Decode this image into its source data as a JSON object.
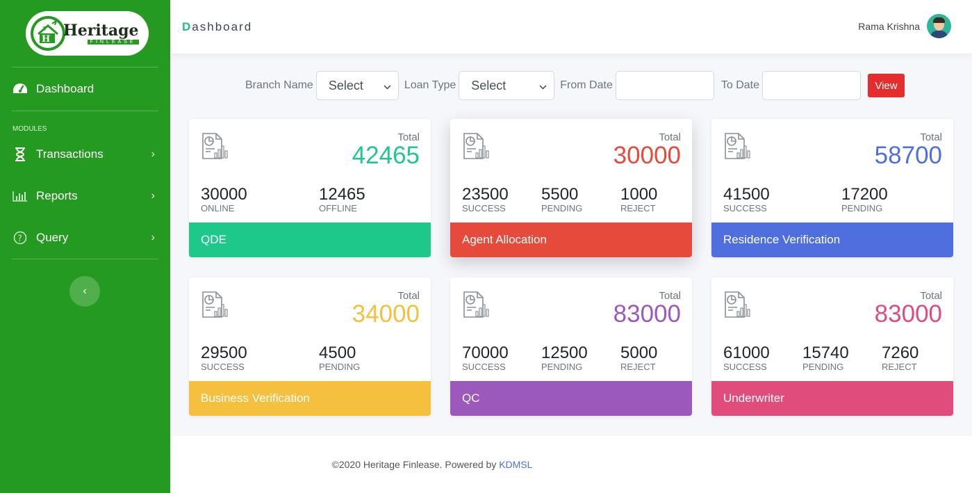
{
  "brand": {
    "name": "Heritage",
    "tagline": "FINLEASE"
  },
  "sidebar": {
    "dashboard_label": "Dashboard",
    "modules_label": "MODULES",
    "items": [
      {
        "label": "Transactions",
        "icon": "hourglass-icon"
      },
      {
        "label": "Reports",
        "icon": "bar-chart-icon"
      },
      {
        "label": "Query",
        "icon": "question-circle-icon"
      }
    ],
    "collapse_icon": "chevron-left-icon"
  },
  "header": {
    "title_first": "D",
    "title_rest": "ashboard",
    "user_name": "Rama Krishna"
  },
  "filters": {
    "branch_label": "Branch Name",
    "branch_value": "Select",
    "loan_label": "Loan Type",
    "loan_value": "Select",
    "from_label": "From Date",
    "from_value": "",
    "to_label": "To Date",
    "to_value": "",
    "view_label": "View"
  },
  "cards": [
    {
      "title": "QDE",
      "total_label": "Total",
      "total": "42465",
      "color": "#1ec88a",
      "stats": [
        {
          "num": "30000",
          "label": "ONLINE"
        },
        {
          "num": "12465",
          "label": "OFFLINE"
        }
      ]
    },
    {
      "title": "Agent Allocation",
      "total_label": "Total",
      "total": "30000",
      "color": "#e64a3b",
      "stats": [
        {
          "num": "23500",
          "label": "SUCCESS"
        },
        {
          "num": "5500",
          "label": "PENDING"
        },
        {
          "num": "1000",
          "label": "REJECT"
        }
      ]
    },
    {
      "title": "Residence Verification",
      "total_label": "Total",
      "total": "58700",
      "color": "#4f6fdf",
      "stats": [
        {
          "num": "41500",
          "label": "SUCCESS"
        },
        {
          "num": "17200",
          "label": "PENDING"
        }
      ]
    },
    {
      "title": "Business Verification",
      "total_label": "Total",
      "total": "34000",
      "color": "#f5c03d",
      "stats": [
        {
          "num": "29500",
          "label": "SUCCESS"
        },
        {
          "num": "4500",
          "label": "PENDING"
        }
      ]
    },
    {
      "title": "QC",
      "total_label": "Total",
      "total": "83000",
      "color": "#9c59bb",
      "stats": [
        {
          "num": "70000",
          "label": "SUCCESS"
        },
        {
          "num": "12500",
          "label": "PENDING"
        },
        {
          "num": "5000",
          "label": "REJECT"
        }
      ]
    },
    {
      "title": "Underwriter",
      "total_label": "Total",
      "total": "83000",
      "color": "#e04d7c",
      "stats": [
        {
          "num": "61000",
          "label": "SUCCESS"
        },
        {
          "num": "15740",
          "label": "PENDING"
        },
        {
          "num": "7260",
          "label": "REJECT"
        }
      ]
    }
  ],
  "footer": {
    "text": "©2020 Heritage Finlease. Powered by ",
    "link": "KDMSL"
  }
}
